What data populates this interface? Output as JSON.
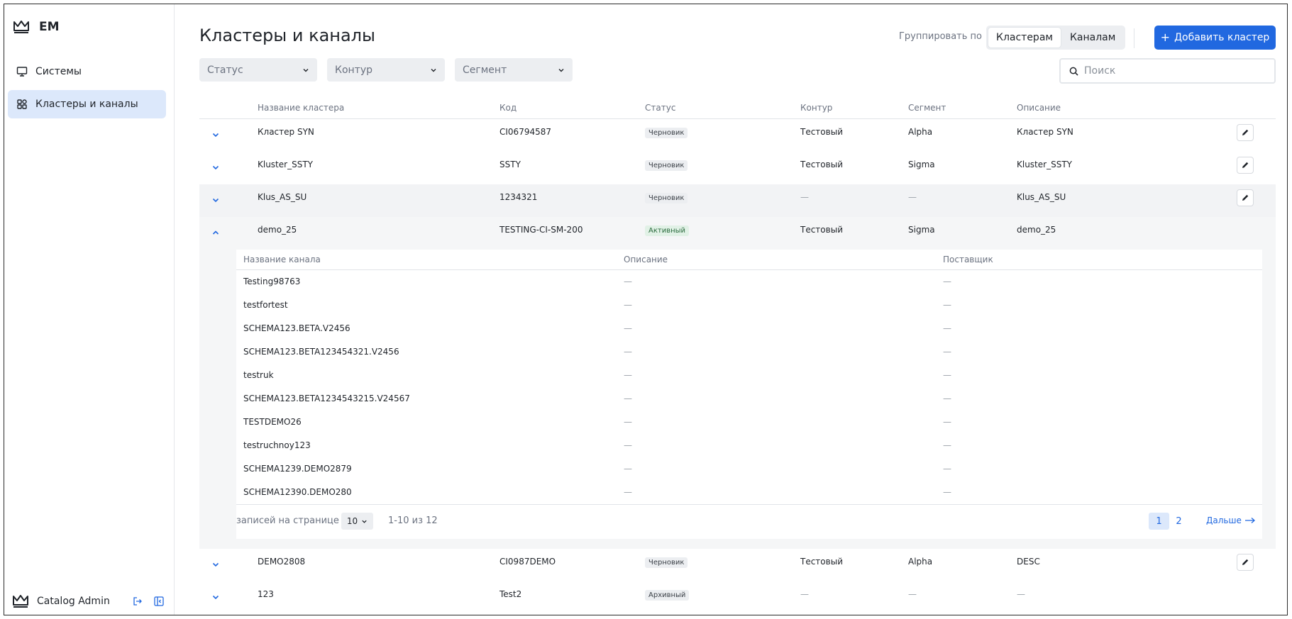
{
  "app": {
    "brand": "EM",
    "nav": [
      {
        "label": "Системы",
        "icon": "monitor-icon",
        "active": false
      },
      {
        "label": "Кластеры и каналы",
        "icon": "grid-icon",
        "active": true
      }
    ],
    "user": "Catalog Admin"
  },
  "header": {
    "title": "Кластеры и каналы",
    "group_by_label": "Группировать по",
    "group_options": [
      "Кластерам",
      "Каналам"
    ],
    "group_selected": "Кластерам",
    "add_button": "Добавить кластер"
  },
  "filters": {
    "status": "Статус",
    "contour": "Контур",
    "segment": "Сегмент",
    "search_placeholder": "Поиск"
  },
  "table": {
    "columns": [
      "Название кластера",
      "Код",
      "Статус",
      "Контур",
      "Сегмент",
      "Описание"
    ],
    "rows_top": [
      {
        "name": "Кластер SYN",
        "code": "CI06794587",
        "status": "Черновик",
        "contour": "Тестовый",
        "segment": "Alpha",
        "description": "Кластер SYN"
      },
      {
        "name": "Kluster_SSTY",
        "code": "SSTY",
        "status": "Черновик",
        "contour": "Тестовый",
        "segment": "Sigma",
        "description": "Kluster_SSTY"
      },
      {
        "name": "Klus_AS_SU",
        "code": "1234321",
        "status": "Черновик",
        "contour": "—",
        "segment": "—",
        "description": "Klus_AS_SU"
      }
    ],
    "expanded_row": {
      "name": "demo_25",
      "code": "TESTING-CI-SM-200",
      "status": "Активный",
      "contour": "Тестовый",
      "segment": "Sigma",
      "description": "demo_25"
    },
    "rows_bottom": [
      {
        "name": "DEMO2808",
        "code": "CI0987DEMO",
        "status": "Черновик",
        "contour": "Тестовый",
        "segment": "Alpha",
        "description": "DESC"
      },
      {
        "name": "123",
        "code": "Test2",
        "status": "Архивный",
        "contour": "—",
        "segment": "—",
        "description": "—"
      }
    ]
  },
  "channels": {
    "columns": [
      "Название канала",
      "Описание",
      "Поставщик"
    ],
    "rows": [
      {
        "name": "Testing98763",
        "description": "—",
        "provider": "—"
      },
      {
        "name": "testfortest",
        "description": "—",
        "provider": "—"
      },
      {
        "name": "SCHEMA123.BETA.V2456",
        "description": "—",
        "provider": "—"
      },
      {
        "name": "SCHEMA123.BETA123454321.V2456",
        "description": "—",
        "provider": "—"
      },
      {
        "name": "testruk",
        "description": "—",
        "provider": "—"
      },
      {
        "name": "SCHEMA123.BETA1234543215.V24567",
        "description": "—",
        "provider": "—"
      },
      {
        "name": "TESTDEMO26",
        "description": "—",
        "provider": "—"
      },
      {
        "name": "testruchnoy123",
        "description": "—",
        "provider": "—"
      },
      {
        "name": "SCHEMA1239.DEMO2879",
        "description": "—",
        "provider": "—"
      },
      {
        "name": "SCHEMA12390.DEMO280",
        "description": "—",
        "provider": "—"
      }
    ],
    "pagination": {
      "per_page_label": "записей на странице",
      "per_page_value": "10",
      "range": "1-10 из 12",
      "pages": [
        "1",
        "2"
      ],
      "current": "1",
      "next_label": "Дальше"
    }
  },
  "colors": {
    "accent": "#2168e0",
    "active_nav": "#dce8fb"
  }
}
